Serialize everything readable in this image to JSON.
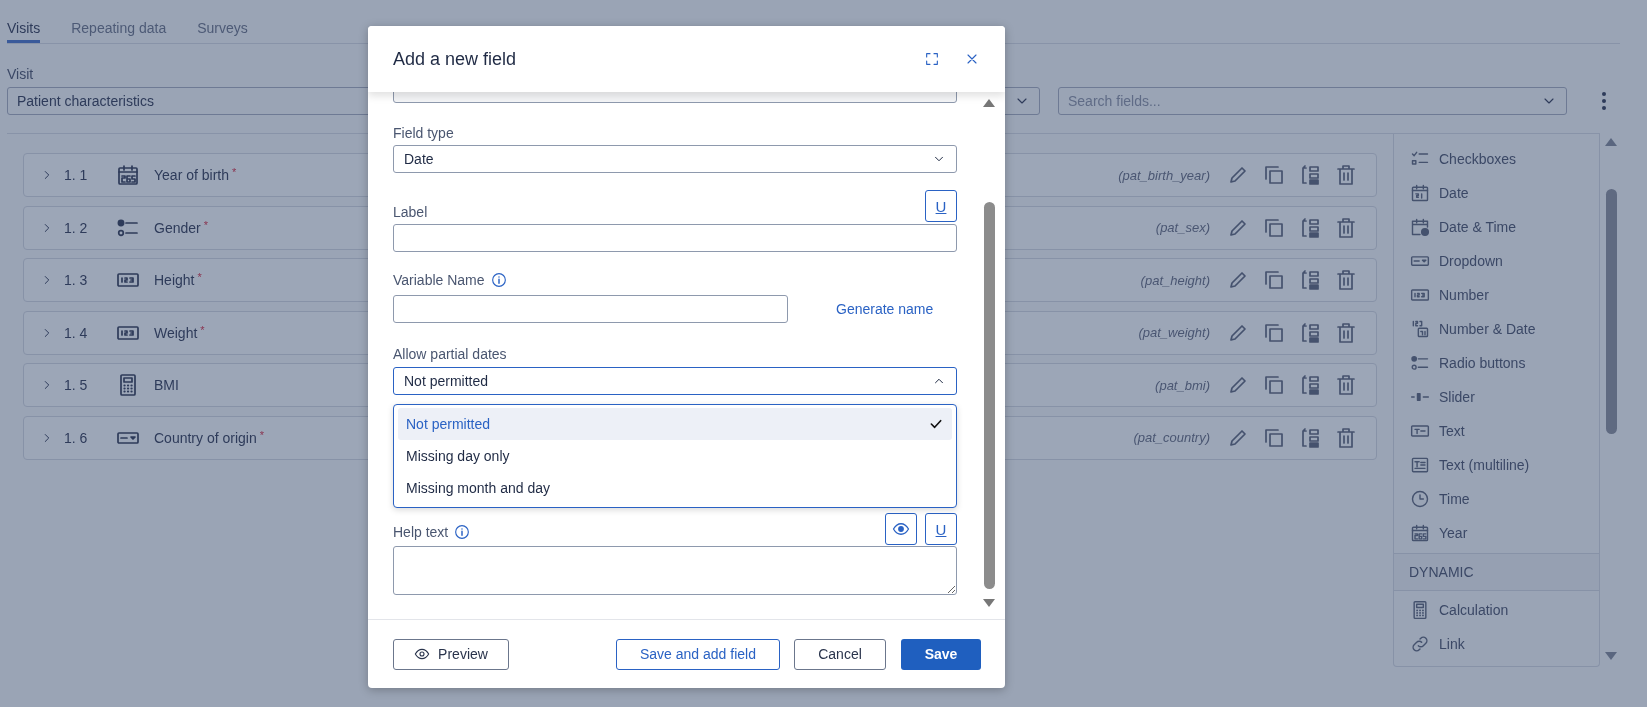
{
  "tabs": [
    {
      "label": "Visits",
      "selected": true
    },
    {
      "label": "Repeating data",
      "selected": false
    },
    {
      "label": "Surveys",
      "selected": false
    }
  ],
  "visit": {
    "label": "Visit",
    "value": "Patient characteristics"
  },
  "search": {
    "placeholder": "Search fields..."
  },
  "fields": [
    {
      "number": "1. 1",
      "kind": "year",
      "label": "Year of birth",
      "marker": "*",
      "variable": "(pat_birth_year)"
    },
    {
      "number": "1. 2",
      "kind": "radio",
      "label": "Gender",
      "marker": "*",
      "variable": "(pat_sex)"
    },
    {
      "number": "1. 3",
      "kind": "number",
      "label": "Height",
      "marker": "*",
      "variable": "(pat_height)"
    },
    {
      "number": "1. 4",
      "kind": "number",
      "label": "Weight",
      "marker": "*",
      "variable": "(pat_weight)"
    },
    {
      "number": "1. 5",
      "kind": "calculation",
      "label": "BMI",
      "variable": "(pat_bmi)"
    },
    {
      "number": "1. 6",
      "kind": "dropdown",
      "label": "Country of origin",
      "marker": "*",
      "variable": "(pat_country)"
    }
  ],
  "palette": {
    "items": [
      {
        "label": "Checkboxes",
        "kind": "checkboxes"
      },
      {
        "label": "Date",
        "kind": "date"
      },
      {
        "label": "Date & Time",
        "kind": "datetime"
      },
      {
        "label": "Dropdown",
        "kind": "dropdown"
      },
      {
        "label": "Number",
        "kind": "number"
      },
      {
        "label": "Number & Date",
        "kind": "numberdate"
      },
      {
        "label": "Radio buttons",
        "kind": "radio"
      },
      {
        "label": "Slider",
        "kind": "slider"
      },
      {
        "label": "Text",
        "kind": "text"
      },
      {
        "label": "Text (multiline)",
        "kind": "multiline"
      },
      {
        "label": "Time",
        "kind": "time"
      },
      {
        "label": "Year",
        "kind": "year"
      }
    ],
    "dynamic": {
      "title": "DYNAMIC",
      "items": [
        {
          "label": "Calculation",
          "kind": "calculation"
        },
        {
          "label": "Link",
          "kind": "link"
        }
      ]
    }
  },
  "dialog": {
    "title": "Add a new field",
    "field_type": {
      "label": "Field type",
      "value": "Date"
    },
    "label_field": {
      "label": "Label",
      "insert": "U"
    },
    "variable_name": {
      "label": "Variable Name",
      "action": "Generate name"
    },
    "partial_dates": {
      "label": "Allow partial dates",
      "value": "Not permitted",
      "expanded": true,
      "options": [
        {
          "label": "Not permitted",
          "selected": true
        },
        {
          "label": "Missing day only",
          "selected": false
        },
        {
          "label": "Missing month and day",
          "selected": false
        }
      ]
    },
    "help_text": {
      "label": "Help text",
      "insert": "U"
    },
    "buttons": [
      {
        "label": "Preview",
        "kind": "preview"
      },
      {
        "label": "Save and add field",
        "kind": "outline"
      },
      {
        "label": "Cancel",
        "kind": "plain"
      },
      {
        "label": "Save",
        "kind": "primary"
      }
    ]
  }
}
